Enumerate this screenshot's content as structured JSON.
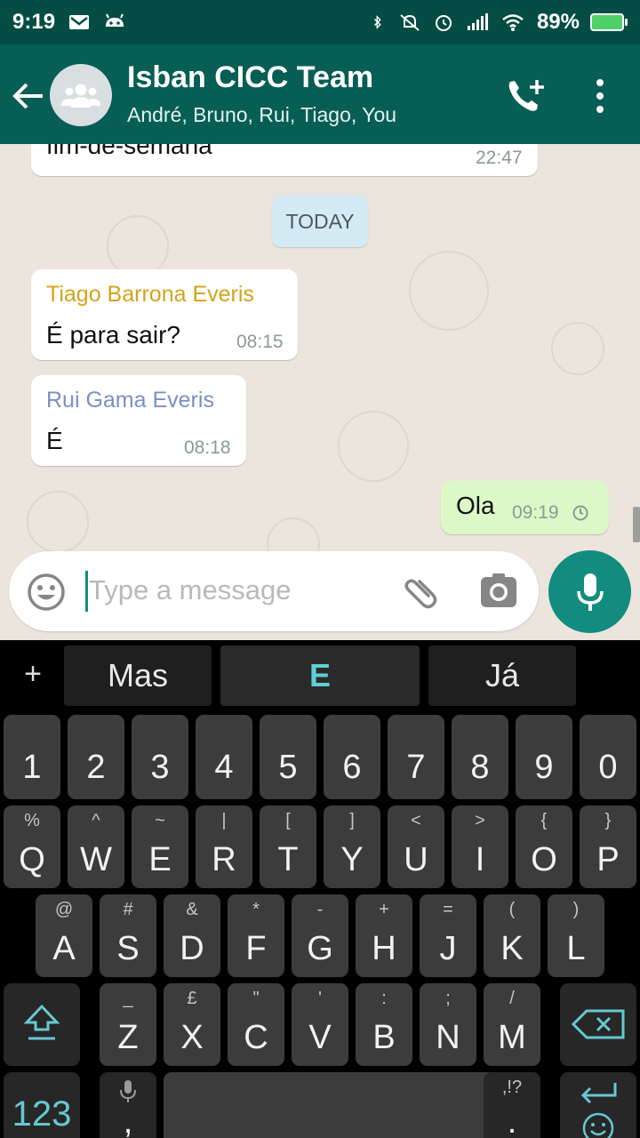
{
  "status_bar": {
    "time": "9:19",
    "battery": "89%"
  },
  "header": {
    "title": "Isban CICC Team",
    "subtitle": "André, Bruno, Rui, Tiago, You"
  },
  "chat": {
    "partial_message": {
      "text": "fim-de-semana",
      "time": "22:47"
    },
    "date_chip": "TODAY",
    "messages": [
      {
        "sender": "Tiago Barrona Everis",
        "sender_color": "#d4a317",
        "text": "É para sair?",
        "time": "08:15"
      },
      {
        "sender": "Rui Gama Everis",
        "sender_color": "#7b8fc6",
        "text": "É",
        "time": "08:18"
      }
    ],
    "outgoing": {
      "text": "Ola",
      "time": "09:19"
    }
  },
  "input": {
    "placeholder": "Type a message"
  },
  "keyboard": {
    "suggestions": [
      "Mas",
      "E",
      "Já"
    ],
    "row_numbers": [
      "1",
      "2",
      "3",
      "4",
      "5",
      "6",
      "7",
      "8",
      "9",
      "0"
    ],
    "row1": [
      {
        "k": "Q",
        "h": "%"
      },
      {
        "k": "W",
        "h": "^"
      },
      {
        "k": "E",
        "h": "~"
      },
      {
        "k": "R",
        "h": "|"
      },
      {
        "k": "T",
        "h": "["
      },
      {
        "k": "Y",
        "h": "]"
      },
      {
        "k": "U",
        "h": "<"
      },
      {
        "k": "I",
        "h": ">"
      },
      {
        "k": "O",
        "h": "{"
      },
      {
        "k": "P",
        "h": "}"
      }
    ],
    "row2": [
      {
        "k": "A",
        "h": "@"
      },
      {
        "k": "S",
        "h": "#"
      },
      {
        "k": "D",
        "h": "&"
      },
      {
        "k": "F",
        "h": "*"
      },
      {
        "k": "G",
        "h": "-"
      },
      {
        "k": "H",
        "h": "+"
      },
      {
        "k": "J",
        "h": "="
      },
      {
        "k": "K",
        "h": "("
      },
      {
        "k": "L",
        "h": ")"
      }
    ],
    "row3": [
      {
        "k": "Z",
        "h": "_"
      },
      {
        "k": "X",
        "h": "£"
      },
      {
        "k": "C",
        "h": "\""
      },
      {
        "k": "V",
        "h": "'"
      },
      {
        "k": "B",
        "h": ":"
      },
      {
        "k": "N",
        "h": ";"
      },
      {
        "k": "M",
        "h": "/"
      }
    ],
    "symbols_key": "123",
    "comma_key": ",",
    "period_key": ".",
    "period_hint": ",!?"
  },
  "colors": {
    "header": "#075e54",
    "status": "#054d44",
    "accent": "#128c7e",
    "outgoing": "#dcf8c6"
  }
}
